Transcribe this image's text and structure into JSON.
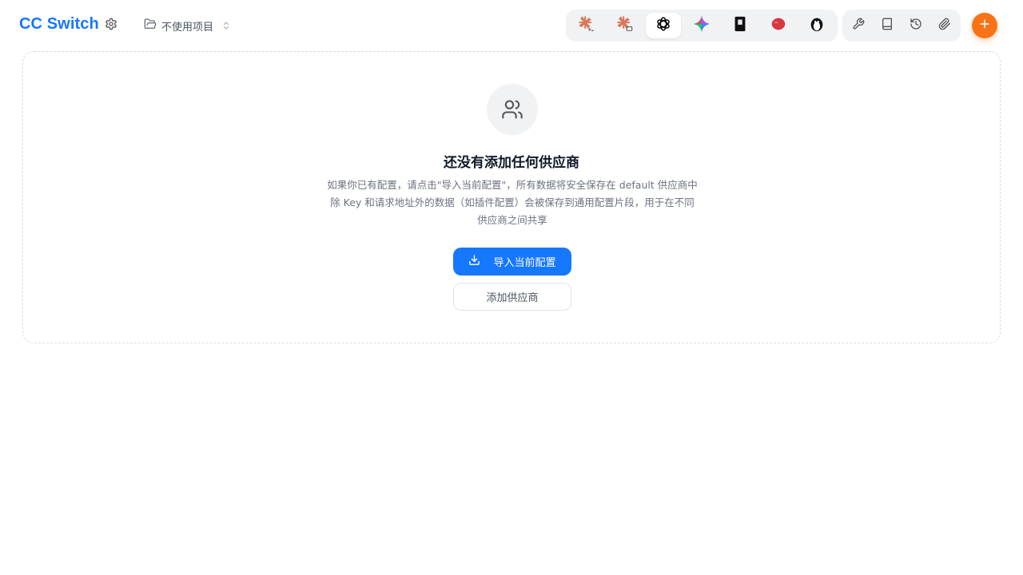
{
  "header": {
    "app_title": "CC Switch",
    "project_label": "不使用项目",
    "icons": {
      "settings": "gear-icon",
      "project": "folder-icon",
      "project_chevron": "chevron-up-down-icon",
      "add": "plus-icon"
    }
  },
  "app_switcher": {
    "items": [
      {
        "name": "claude-code",
        "icon": "claude-terminal-icon",
        "active": false
      },
      {
        "name": "claude-desktop",
        "icon": "claude-desktop-icon",
        "active": false
      },
      {
        "name": "codex",
        "icon": "openai-icon",
        "active": true
      },
      {
        "name": "gemini",
        "icon": "gemini-icon",
        "active": false
      },
      {
        "name": "tool-5",
        "icon": "black-rectangle-icon",
        "active": false
      },
      {
        "name": "tool-6",
        "icon": "red-fruit-icon",
        "active": false
      },
      {
        "name": "tool-7",
        "icon": "penguin-icon",
        "active": false
      }
    ]
  },
  "toolbar": {
    "items": [
      "wrench-icon",
      "book-icon",
      "history-icon",
      "paperclip-icon"
    ]
  },
  "colors": {
    "brand": "#1677ff",
    "accent_orange": "#f97316",
    "primary_button": "#1677ff"
  },
  "empty_state": {
    "icon": "users-icon",
    "title": "还没有添加任何供应商",
    "description_lines": [
      "如果你已有配置，请点击\"导入当前配置\"，所有数据将安全保存在 default 供应商中",
      "除 Key 和请求地址外的数据（如插件配置）会被保存到通用配置片段，用于在不同",
      "供应商之间共享"
    ],
    "import_label": "导入当前配置",
    "add_label": "添加供应商"
  }
}
